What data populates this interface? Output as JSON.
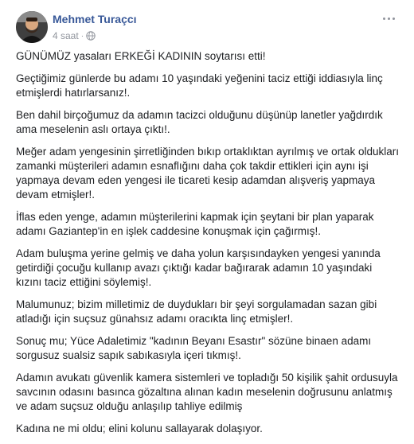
{
  "post": {
    "author": "Mehmet Turaçcı",
    "time": "4 saat",
    "dot": "·",
    "paragraphs": [
      "GÜNÜMÜZ yasaları ERKEĞİ KADININ soytarısı etti!",
      "Geçtiğimiz günlerde bu adamı 10 yaşındaki yeğenini taciz ettiği iddiasıyla linç etmişlerdi hatırlarsanız!.",
      "Ben dahil birçoğumuz da adamın tacizci olduğunu düşünüp lanetler yağdırdık ama meselenin aslı ortaya çıktı!.",
      "Meğer adam yengesinin şirretliğinden bıkıp ortaklıktan ayrılmış ve ortak oldukları zamanki müşterileri adamın esnaflığını daha çok takdir ettikleri için aynı işi yapmaya devam eden yengesi ile ticareti kesip adamdan alışveriş yapmaya devam etmişler!.",
      "İflas eden yenge, adamın müşterilerini kapmak için şeytani bir plan yaparak adamı Gaziantep'in en işlek caddesine konuşmak için çağırmış!.",
      "Adam buluşma yerine gelmiş ve daha yolun karşısındayken yengesi yanında getirdiği çocuğu kullanıp avazı çıktığı kadar bağırarak adamın 10 yaşındaki kızını taciz ettiğini söylemiş!.",
      "Malumunuz; bizim milletimiz de duydukları bir şeyi sorgulamadan sazan gibi atladığı için suçsuz günahsız adamı oracıkta linç etmişler!.",
      "Sonuç mu; Yüce Adaletimiz \"kadının Beyanı Esastır\" sözüne binaen adamı sorgusuz sualsiz sapık sabıkasıyla içeri tıkmış!.",
      "Adamın avukatı güvenlik kamera sistemleri ve topladığı 50 kişilik şahit ordusuyla savcının odasını basınca gözaltına alınan kadın meselenin doğrusunu anlatmış ve adam suçsuz olduğu anlaşılıp tahliye edilmiş",
      "Kadına ne mi oldu; elini kolunu sallayarak dolaşıyor."
    ]
  },
  "icons": {
    "avatar": "avatar-photo",
    "privacy": "globe-icon",
    "menu": "more-options-icon"
  }
}
